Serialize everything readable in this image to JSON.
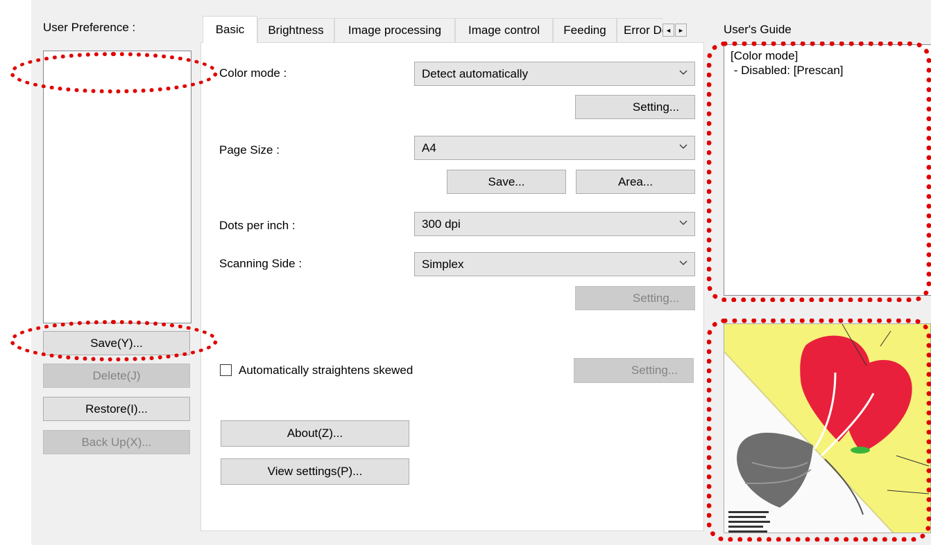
{
  "user_preference": {
    "label": "User Preference :",
    "save": "Save(Y)...",
    "delete": "Delete(J)",
    "restore": "Restore(I)...",
    "backup": "Back Up(X)..."
  },
  "tabs": [
    "Basic",
    "Brightness",
    "Image processing",
    "Image control",
    "Feeding",
    "Error De"
  ],
  "tab_scroll": {
    "left": "◄",
    "right": "►"
  },
  "basic": {
    "color_mode_label": "Color mode :",
    "color_mode_value": "Detect automatically",
    "color_setting": "Setting...",
    "page_size_label": "Page Size :",
    "page_size_value": "A4",
    "save": "Save...",
    "area": "Area...",
    "dpi_label": "Dots per inch :",
    "dpi_value": "300 dpi",
    "side_label": "Scanning Side :",
    "side_value": "Simplex",
    "side_setting": "Setting...",
    "skew_label": "Automatically straightens skewed",
    "skew_checked": false,
    "skew_setting": "Setting...",
    "about": "About(Z)...",
    "view_settings": "View settings(P)..."
  },
  "guide": {
    "title": "User's Guide",
    "lines": [
      "[Color mode]",
      " - Disabled: [Prescan]"
    ]
  },
  "colors": {
    "annotation": "#e00000",
    "preview_red": "#e8203c",
    "preview_yellow": "#f6f37a"
  },
  "icons": [
    "chevron-down-icon",
    "scroll-left-icon",
    "scroll-right-icon",
    "checkbox-icon"
  ]
}
